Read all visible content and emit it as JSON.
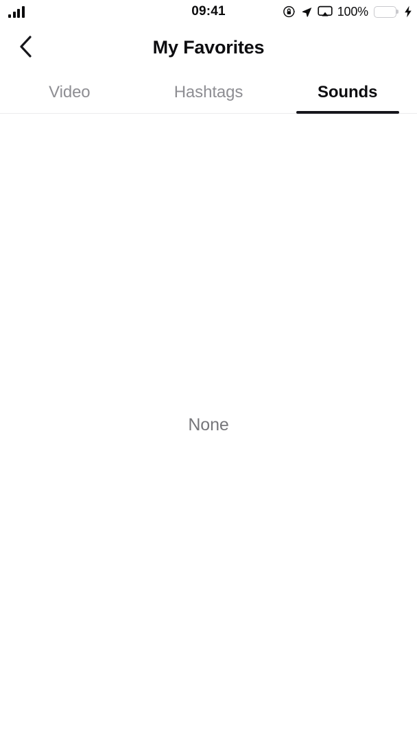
{
  "status_bar": {
    "time": "09:41",
    "battery_percent": "100%",
    "icons": {
      "signal": "signal-bars-icon",
      "rotation_lock": "rotation-lock-icon",
      "location": "location-arrow-icon",
      "airplay": "screen-mirroring-icon",
      "battery": "battery-icon",
      "charging": "charging-bolt-icon"
    },
    "colors": {
      "battery_fill": "#4ce24c",
      "battery_border": "#c9c9cd",
      "text": "#0b0b0c"
    }
  },
  "header": {
    "title": "My Favorites",
    "back_icon": "chevron-left-icon"
  },
  "tabs": {
    "items": [
      {
        "label": "Video",
        "active": false
      },
      {
        "label": "Hashtags",
        "active": false
      },
      {
        "label": "Sounds",
        "active": true
      }
    ],
    "active_index": 2,
    "colors": {
      "active_text": "#0d0d10",
      "inactive_text": "#8e8e93",
      "indicator": "#16161c",
      "divider": "#ececed"
    }
  },
  "content": {
    "empty_state_text": "None",
    "empty_state_color": "#76767a"
  }
}
